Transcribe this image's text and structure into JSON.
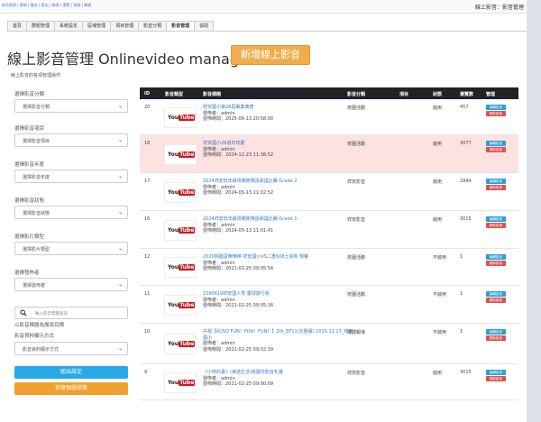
{
  "topbar": {
    "breadcrumb": "前台首頁 | 更新 | 後台 | 登出 | 修改 | 瀏覽 | 系統 | 網頁",
    "system_name": "線上影音：影音管理"
  },
  "tabs": [
    "首頁",
    "群組管理",
    "系統設定",
    "區塊管理",
    "項目管理",
    "影音分類",
    "影音管理",
    "協助"
  ],
  "active_tab_index": 6,
  "page": {
    "title": "線上影音管理 Onlinevideo management",
    "add_button": "新增線上影音",
    "subtitle": "線上影音的各項管理操作"
  },
  "sidebar": {
    "category_label": "選擇影音分類",
    "category_value": "選擇影音分類",
    "item_label": "選擇影音項目",
    "item_value": "選擇影音項目",
    "year_label": "選擇影音年度",
    "year_value": "選擇影音年度",
    "status_label": "選擇影音狀態",
    "status_value": "選擇影音狀態",
    "type_label": "選擇影片類型",
    "type_value": "選擇影片類型",
    "publisher_label": "選擇發佈者",
    "publisher_value": "選擇發佈者",
    "search_placeholder": "輸入影音標題查詢",
    "search_hint": "以影音標題為搜尋目標",
    "sort_label": "影音資料顯示方式",
    "sort_value": "影音資料顯示方式",
    "save_button": "組出設定",
    "reset_button": "恢復預設狀態"
  },
  "table": {
    "headers": {
      "id": "ID",
      "type": "影音類型",
      "title": "影音標題",
      "category": "影音分類",
      "item": "項目",
      "status": "狀態",
      "views": "瀏覽數",
      "manage": "管理"
    },
    "edit_label": "編輯影音",
    "delete_label": "刪除影音",
    "thumb_text_a": "You",
    "thumb_text_b": "Tube",
    "rows": [
      {
        "id": "20",
        "title": "祥安國小第28屆畢業典禮",
        "category": "校園活動",
        "status": "啟用",
        "views": "457",
        "author": "發佈者：admin",
        "date": "發佈時間：2025-06-13 20:58:00"
      },
      {
        "id": "18",
        "title": "祥安國小28週年校慶",
        "category": "校園活動",
        "status": "啟用",
        "views": "3077",
        "author": "發佈者：admin",
        "date": "發佈時間：2024-12-23 11:36:52"
      },
      {
        "id": "17",
        "title": "2024祥安低年級母親節英語歌謠比賽-Grade 2",
        "category": "祥安影音",
        "status": "啟用",
        "views": "2994",
        "author": "發佈者：admin",
        "date": "發佈時間：2024-05-13 11:02:52"
      },
      {
        "id": "16",
        "title": "2024祥安低年級母親節英語歌謠比賽-Grade 1",
        "category": "祥安影音",
        "status": "啟用",
        "views": "3015",
        "author": "發佈者：admin",
        "date": "發佈時間：2024-05-13 11:01:41"
      },
      {
        "id": "12",
        "title": "2020桃園盃樂樂棒 祥安國小VS二重608土蚓魚 預賽",
        "category": "校園活動",
        "status": "不啟用",
        "views": "1",
        "author": "發佈者：admin",
        "date": "發佈時間：2021-02-25 09:05:54"
      },
      {
        "id": "11",
        "title": "1090619祥安國人秀 靈球旅行衛",
        "category": "校園活動",
        "status": "不啟用",
        "views": "1",
        "author": "發佈者：admin",
        "date": "發佈時間：2021-02-25 09:05:16"
      },
      {
        "id": "10",
        "title": "中視【KUSO FUN！FUN！FUN！】2th_EP11(完整版) 2015.11.27_祥安國小",
        "category": "媒體報導",
        "status": "不啟用",
        "views": "1",
        "author": "發佈者：admin",
        "date": "發佈時間：2021-02-25 09:02:39"
      },
      {
        "id": "9",
        "title": "《小修的書》(美感生活)桃園市影音札擾",
        "category": "祥安影音",
        "status": "啟用",
        "views": "3015",
        "author": "發佈者：admin",
        "date": "發佈時間：2021-02-25 09:00:09"
      }
    ]
  },
  "colors": {
    "accent_orange": "#f0ad4e",
    "accent_blue": "#29a8e8",
    "header_dark": "#1f2328",
    "highlight_row": "#fde2e2",
    "delete_red": "#d9534f"
  }
}
